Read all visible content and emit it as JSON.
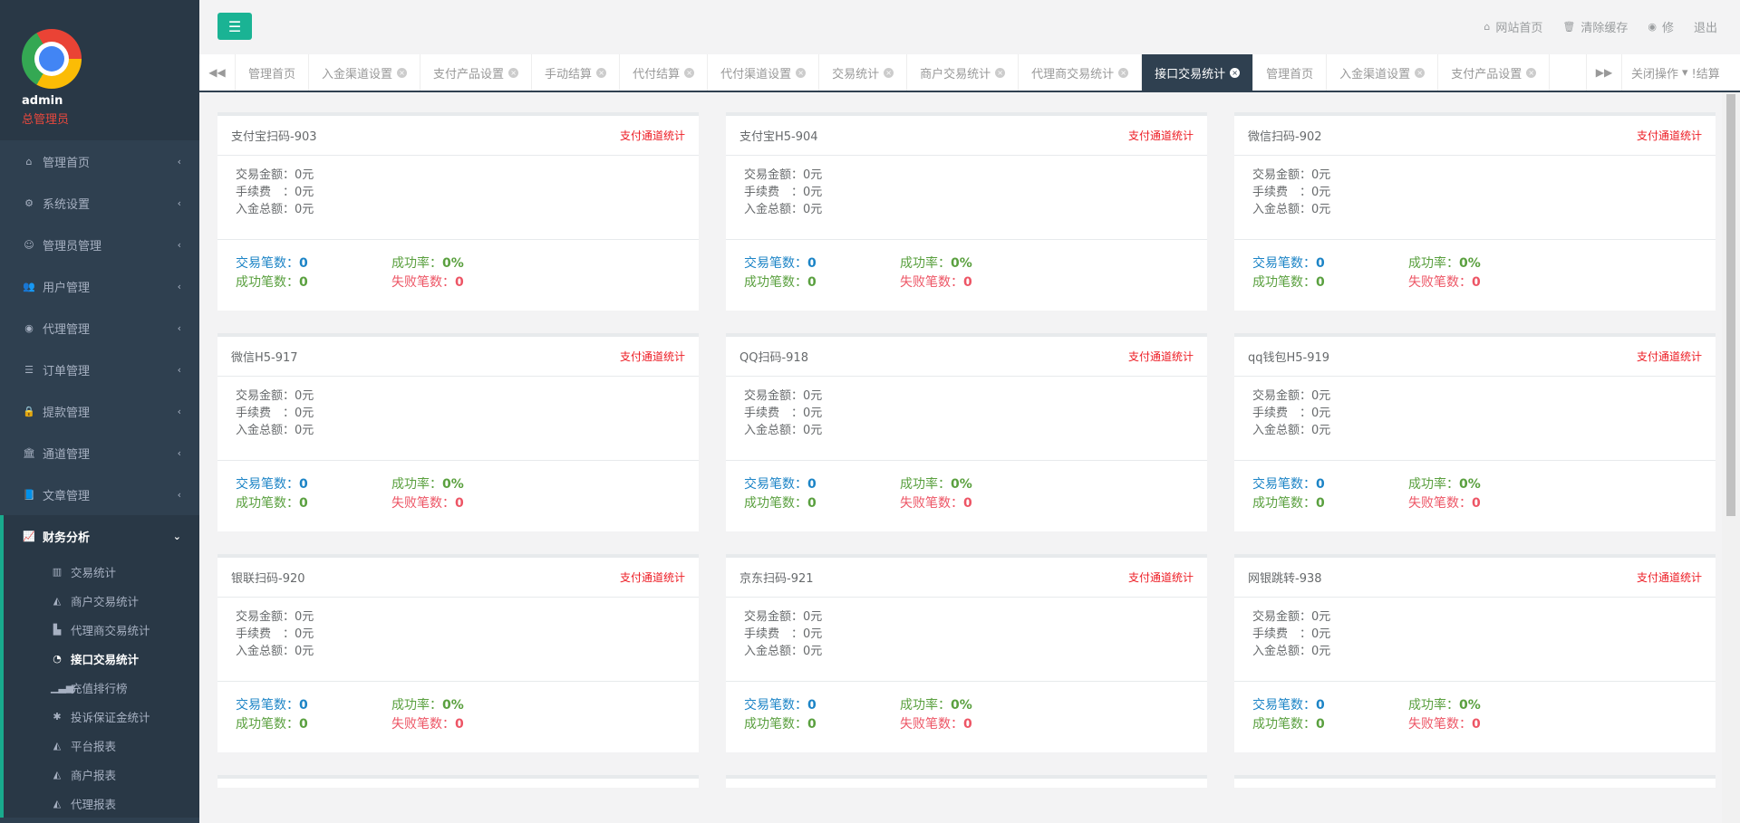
{
  "sidebar": {
    "username": "admin",
    "role": "总管理员",
    "items": [
      {
        "label": "管理首页",
        "icon": "home-icon",
        "glyph": "⌂"
      },
      {
        "label": "系统设置",
        "icon": "gears-icon",
        "glyph": "⚙"
      },
      {
        "label": "管理员管理",
        "icon": "user-circle-icon",
        "glyph": "☺"
      },
      {
        "label": "用户管理",
        "icon": "users-icon",
        "glyph": "👥"
      },
      {
        "label": "代理管理",
        "icon": "eye-icon",
        "glyph": "◉"
      },
      {
        "label": "订单管理",
        "icon": "list-icon",
        "glyph": "☰"
      },
      {
        "label": "提款管理",
        "icon": "lock-icon",
        "glyph": "🔒"
      },
      {
        "label": "通道管理",
        "icon": "bank-icon",
        "glyph": "🏛"
      },
      {
        "label": "文章管理",
        "icon": "book-icon",
        "glyph": "📘"
      }
    ],
    "group": {
      "label": "财务分析",
      "icon": "line-chart-icon",
      "glyph": "📈",
      "arrow": "⌄",
      "children": [
        {
          "label": "交易统计",
          "icon": "bar-chart-icon",
          "glyph": "▥"
        },
        {
          "label": "商户交易统计",
          "icon": "area-chart-icon",
          "glyph": "◭"
        },
        {
          "label": "代理商交易统计",
          "icon": "industry-icon",
          "glyph": "▙"
        },
        {
          "label": "接口交易统计",
          "icon": "pie-chart-icon",
          "glyph": "◔",
          "active": true
        },
        {
          "label": "充值排行榜",
          "icon": "signal-icon",
          "glyph": "▁▃▅"
        },
        {
          "label": "投诉保证金统计",
          "icon": "asterisk-icon",
          "glyph": "✱"
        },
        {
          "label": "平台报表",
          "icon": "area-chart-icon",
          "glyph": "◭"
        },
        {
          "label": "商户报表",
          "icon": "area-chart-icon",
          "glyph": "◭"
        },
        {
          "label": "代理报表",
          "icon": "area-chart-icon",
          "glyph": "◭"
        }
      ]
    },
    "arrow": "‹"
  },
  "topbar": {
    "menu_glyph": "☰",
    "links": [
      {
        "label": "网站首页",
        "icon": "home-icon",
        "glyph": "⌂"
      },
      {
        "label": "清除缓存",
        "icon": "trash-icon",
        "glyph": "🗑"
      },
      {
        "label": "修",
        "icon": "eye-icon",
        "glyph": "◉"
      },
      {
        "label": "退出",
        "icon": "",
        "glyph": ""
      }
    ]
  },
  "tabs": {
    "prev_glyph": "◀◀",
    "next_glyph": "▶▶",
    "close_glyph": "×",
    "items": [
      {
        "label": "管理首页",
        "closable": false
      },
      {
        "label": "入金渠道设置",
        "closable": true
      },
      {
        "label": "支付产品设置",
        "closable": true
      },
      {
        "label": "手动结算",
        "closable": true
      },
      {
        "label": "代付结算",
        "closable": true
      },
      {
        "label": "代付渠道设置",
        "closable": true
      },
      {
        "label": "交易统计",
        "closable": true
      },
      {
        "label": "商户交易统计",
        "closable": true
      },
      {
        "label": "代理商交易统计",
        "closable": true
      },
      {
        "label": "接口交易统计",
        "closable": true,
        "active": true
      },
      {
        "label": "管理首页",
        "closable": false
      },
      {
        "label": "入金渠道设置",
        "closable": true
      },
      {
        "label": "支付产品设置",
        "closable": true
      }
    ],
    "close_ops_label": "关闭操作",
    "close_ops_caret": "▾",
    "close_ops_overflow": "!结算"
  },
  "labels": {
    "tag": "支付通道统计",
    "amount": "交易金额：",
    "fee": "手续费　：",
    "total": "入金总额：",
    "count": "交易笔数：",
    "rate": "成功率：",
    "success": "成功笔数：",
    "fail": "失败笔数："
  },
  "channels": [
    {
      "title": "支付宝扫码-903",
      "amount": "0元",
      "fee": "0元",
      "total": "0元",
      "count": "0",
      "rate": "0%",
      "success": "0",
      "fail": "0"
    },
    {
      "title": "支付宝H5-904",
      "amount": "0元",
      "fee": "0元",
      "total": "0元",
      "count": "0",
      "rate": "0%",
      "success": "0",
      "fail": "0"
    },
    {
      "title": "微信扫码-902",
      "amount": "0元",
      "fee": "0元",
      "total": "0元",
      "count": "0",
      "rate": "0%",
      "success": "0",
      "fail": "0"
    },
    {
      "title": "微信H5-917",
      "amount": "0元",
      "fee": "0元",
      "total": "0元",
      "count": "0",
      "rate": "0%",
      "success": "0",
      "fail": "0"
    },
    {
      "title": "QQ扫码-918",
      "amount": "0元",
      "fee": "0元",
      "total": "0元",
      "count": "0",
      "rate": "0%",
      "success": "0",
      "fail": "0"
    },
    {
      "title": "qq钱包H5-919",
      "amount": "0元",
      "fee": "0元",
      "total": "0元",
      "count": "0",
      "rate": "0%",
      "success": "0",
      "fail": "0"
    },
    {
      "title": "银联扫码-920",
      "amount": "0元",
      "fee": "0元",
      "total": "0元",
      "count": "0",
      "rate": "0%",
      "success": "0",
      "fail": "0"
    },
    {
      "title": "京东扫码-921",
      "amount": "0元",
      "fee": "0元",
      "total": "0元",
      "count": "0",
      "rate": "0%",
      "success": "0",
      "fail": "0"
    },
    {
      "title": "网银跳转-938",
      "amount": "0元",
      "fee": "0元",
      "total": "0元",
      "count": "0",
      "rate": "0%",
      "success": "0",
      "fail": "0"
    }
  ],
  "colors": {
    "accent": "#1ab394",
    "sidebar": "#2f4050",
    "tag": "#ed1c24",
    "count": "#1c84c6",
    "success": "#5aa03f",
    "fail": "#ed5565"
  }
}
